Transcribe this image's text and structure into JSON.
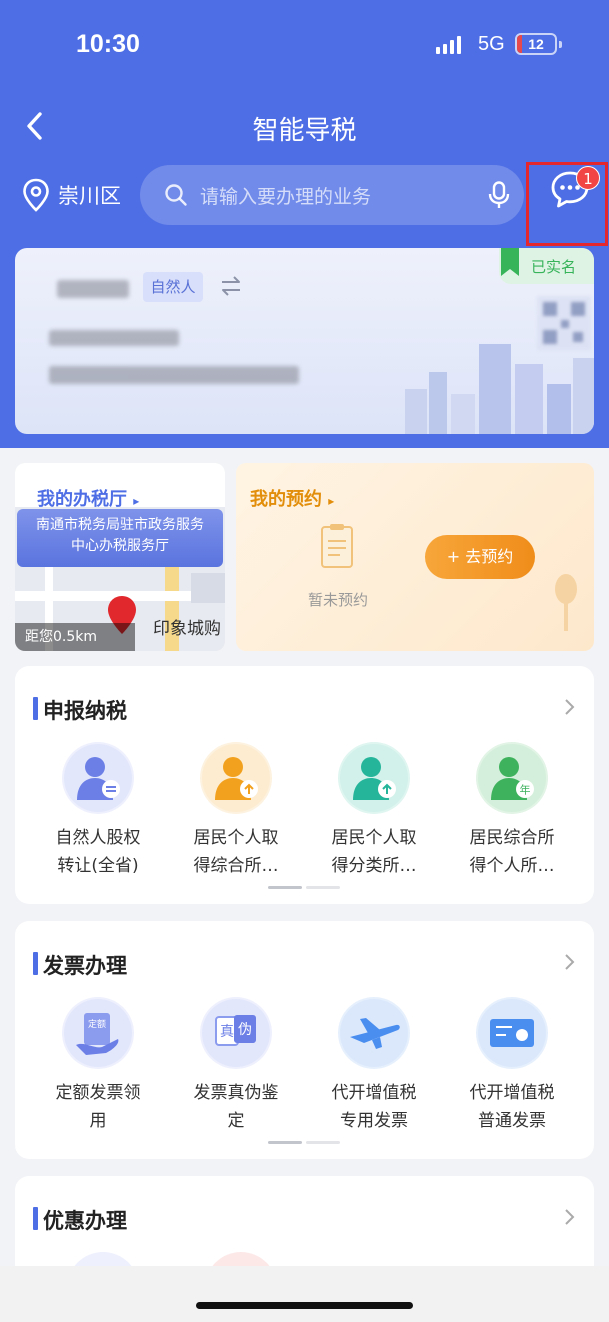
{
  "status": {
    "time": "10:30",
    "network": "5G",
    "battery": "12",
    "battery_level": 0.12
  },
  "header": {
    "title": "智能导税"
  },
  "location": {
    "district": "崇川区"
  },
  "search": {
    "placeholder": "请输入要办理的业务"
  },
  "messages": {
    "badge_count": "1"
  },
  "identity_card": {
    "type_tag": "自然人",
    "verified_label": "已实名"
  },
  "tax_hall": {
    "title": "我的办税厅",
    "hall_name_line1": "南通市税务局驻市政务服务",
    "hall_name_line2": "中心办税服务厅",
    "distance": "距您0.5km",
    "poi": "印象城购"
  },
  "appointment": {
    "title": "我的预约",
    "empty_text": "暂未预约",
    "button_label": "+ 去预约"
  },
  "sections": [
    {
      "title": "申报纳税",
      "items": [
        {
          "label_line1": "自然人股权",
          "label_line2": "转让(全省)",
          "icon": "person-transfer-icon",
          "color": "#6b7fe6",
          "bg": "#eef0fd"
        },
        {
          "label_line1": "居民个人取",
          "label_line2": "得综合所…",
          "icon": "person-income-icon",
          "color": "#f2a11e",
          "bg": "#fdf2df"
        },
        {
          "label_line1": "居民个人取",
          "label_line2": "得分类所…",
          "icon": "person-classified-icon",
          "color": "#25b59a",
          "bg": "#dff5f0"
        },
        {
          "label_line1": "居民综合所",
          "label_line2": "得个人所…",
          "icon": "person-annual-icon",
          "color": "#3fb25d",
          "bg": "#e1f4e5"
        }
      ]
    },
    {
      "title": "发票办理",
      "items": [
        {
          "label_line1": "定额发票领",
          "label_line2": "用",
          "icon": "fixed-invoice-icon",
          "color": "#6b7fe6",
          "bg": "#eef0fd"
        },
        {
          "label_line1": "发票真伪鉴",
          "label_line2": "定",
          "icon": "invoice-verify-icon",
          "color": "#6b7fe6",
          "bg": "#eef0fd"
        },
        {
          "label_line1": "代开增值税",
          "label_line2": "专用发票",
          "icon": "airplane-icon",
          "color": "#4a8ef0",
          "bg": "#e6f0fd"
        },
        {
          "label_line1": "代开增值税",
          "label_line2": "普通发票",
          "icon": "ticket-icon",
          "color": "#4a8ef0",
          "bg": "#e6f0fd"
        }
      ]
    },
    {
      "title": "优惠办理"
    }
  ],
  "icon_glyphs": {
    "verify_true": "真",
    "verify_fake": "伪",
    "fixed_tag": "定额",
    "annual_tag": "年"
  }
}
